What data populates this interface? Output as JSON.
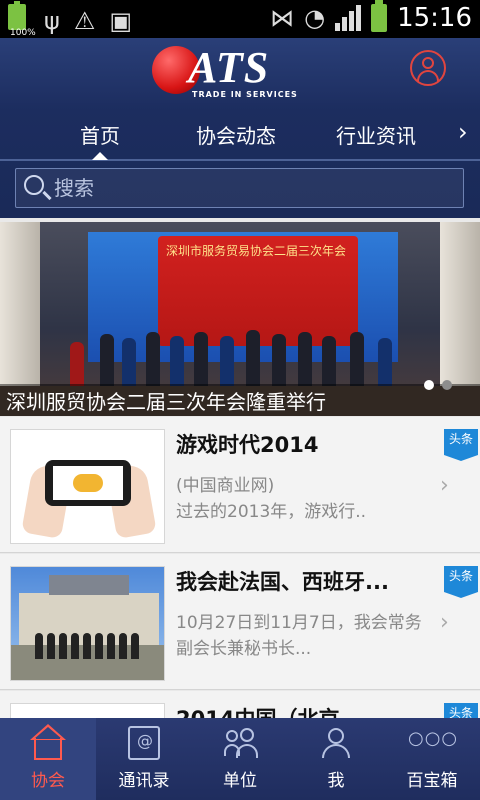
{
  "status_bar": {
    "battery_percent": "100%",
    "time": "15:16"
  },
  "header": {
    "logo_text": "ATS",
    "logo_subtitle": "TRADE IN SERVICES"
  },
  "tabs": [
    {
      "label": "首页",
      "active": true
    },
    {
      "label": "协会动态",
      "active": false
    },
    {
      "label": "行业资讯",
      "active": false
    }
  ],
  "search": {
    "placeholder": "搜索"
  },
  "banner": {
    "sign_text": "深圳市服务贸易协会二届三次年会",
    "caption": "深圳服贸协会二届三次年会隆重举行",
    "slide_index": 1,
    "slide_count": 3
  },
  "news": [
    {
      "title": "游戏时代2014",
      "desc": "(中国商业网)\n过去的2013年，游戏行..",
      "tag": "头条"
    },
    {
      "title": "我会赴法国、西班牙...",
      "desc": "10月27日到11月7日，我会常务副会长兼秘书长...",
      "tag": "头条"
    },
    {
      "title": "2014中国（北京",
      "desc": "",
      "tag": "头条"
    }
  ],
  "bottom_nav": [
    {
      "label": "协会",
      "active": true
    },
    {
      "label": "通讯录",
      "active": false
    },
    {
      "label": "单位",
      "active": false
    },
    {
      "label": "我",
      "active": false
    },
    {
      "label": "百宝箱",
      "active": false
    }
  ],
  "colors": {
    "header_bg": "#1c2d5f",
    "accent_red": "#ff5a4e",
    "tag_blue": "#1e88d8"
  }
}
